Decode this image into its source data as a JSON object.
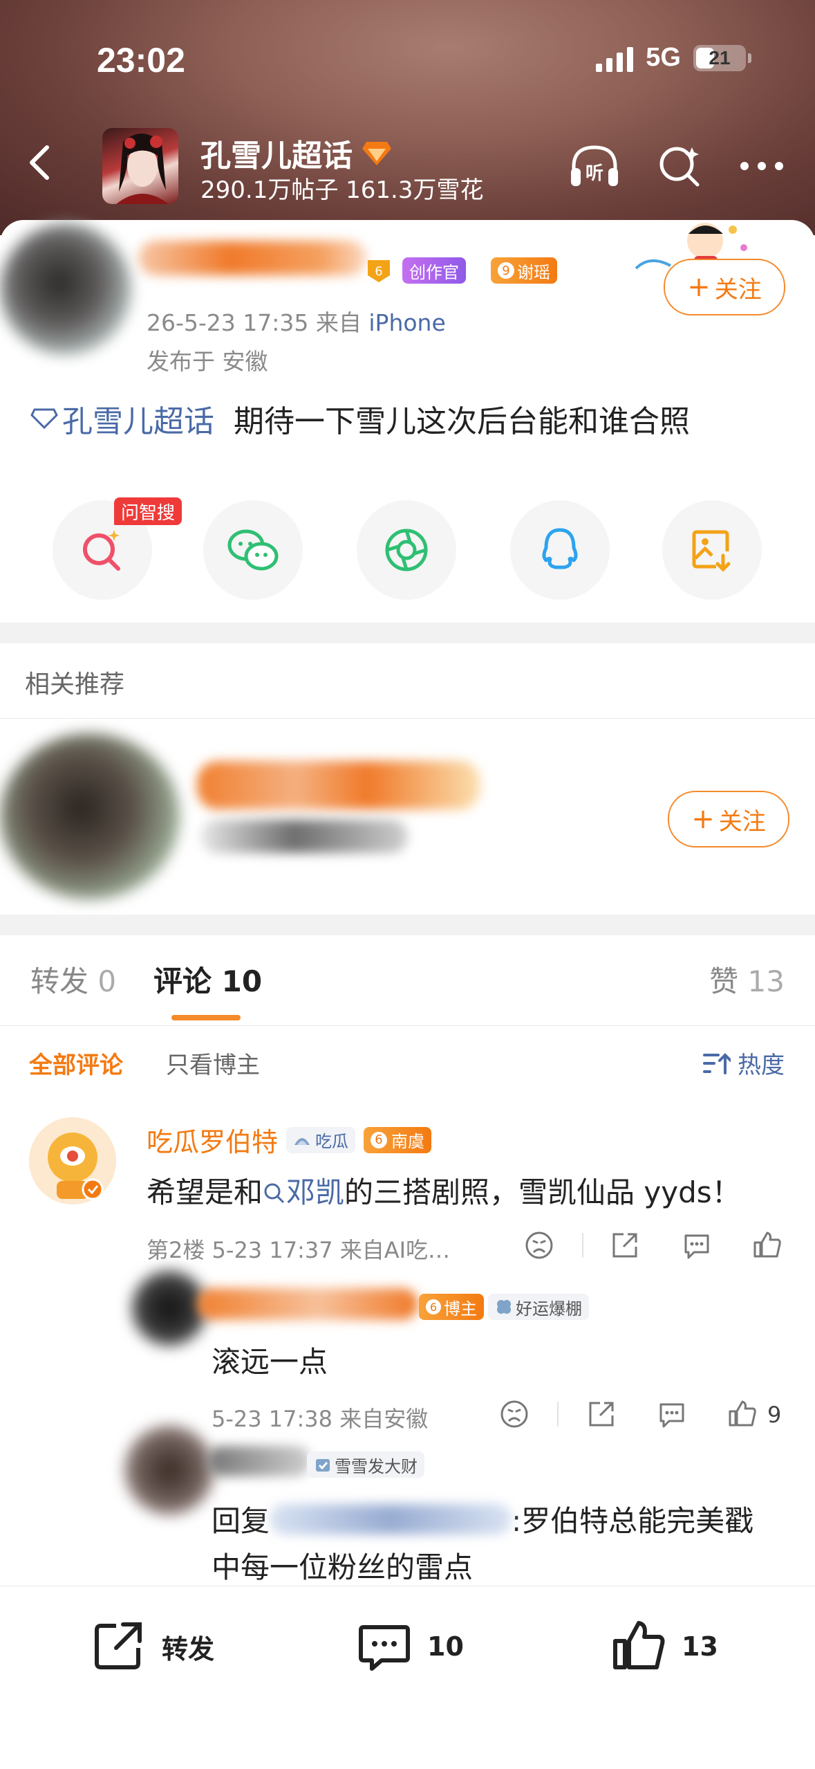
{
  "status_bar": {
    "time": "23:02",
    "network": "5G",
    "battery": "21"
  },
  "topic": {
    "title": "孔雪儿超话",
    "stats": "290.1万帖子 161.3万雪花",
    "listen_label": "听"
  },
  "post": {
    "badges": {
      "creator": "创作官",
      "level_name": "谢瑶",
      "level_num": "9",
      "small_level": "6"
    },
    "time_source_prefix": "26-5-23 17:35  来自",
    "source": "iPhone",
    "location": "发布于 安徽",
    "follow_label": "关注",
    "topic_link": "孔雪儿超话",
    "text": "期待一下雪儿这次后台能和谁合照"
  },
  "share": {
    "ai_search_tag": "问智搜"
  },
  "recommend": {
    "title": "相关推荐",
    "follow_label": "关注"
  },
  "tabs": {
    "repost_label": "转发",
    "repost_count": "0",
    "comment_label": "评论",
    "comment_count": "10",
    "like_label": "赞",
    "like_count": "13"
  },
  "filters": {
    "all": "全部评论",
    "owner_only": "只看博主",
    "sort": "热度"
  },
  "comments": [
    {
      "name": "吃瓜罗伯特",
      "badge_group": "吃瓜",
      "badge_level_num": "6",
      "badge_level_name": "南虞",
      "text_prefix": "希望是和",
      "mention": "邓凯",
      "text_suffix": "的三搭剧照，雪凯仙品 yyds！",
      "meta": "第2楼  5-23 17:37  来自AI吃…"
    }
  ],
  "replies": [
    {
      "badge_owner": "博主",
      "badge_owner_num": "6",
      "badge_fan": "好运爆棚",
      "text": "滚远一点",
      "meta": "5-23 17:38  来自安徽",
      "likes": "9"
    },
    {
      "badge_fan": "雪雪发大财",
      "text_prefix": "回复",
      "text_suffix": ":罗伯特总能完美戳",
      "text_line2": "中每一位粉丝的雷点"
    }
  ],
  "bottom_bar": {
    "repost_label": "转发",
    "comment_count": "10",
    "like_count": "13"
  },
  "colors": {
    "accent": "#f37a12",
    "link": "#4a6aa6",
    "creator_purple": "#b56ee8"
  }
}
